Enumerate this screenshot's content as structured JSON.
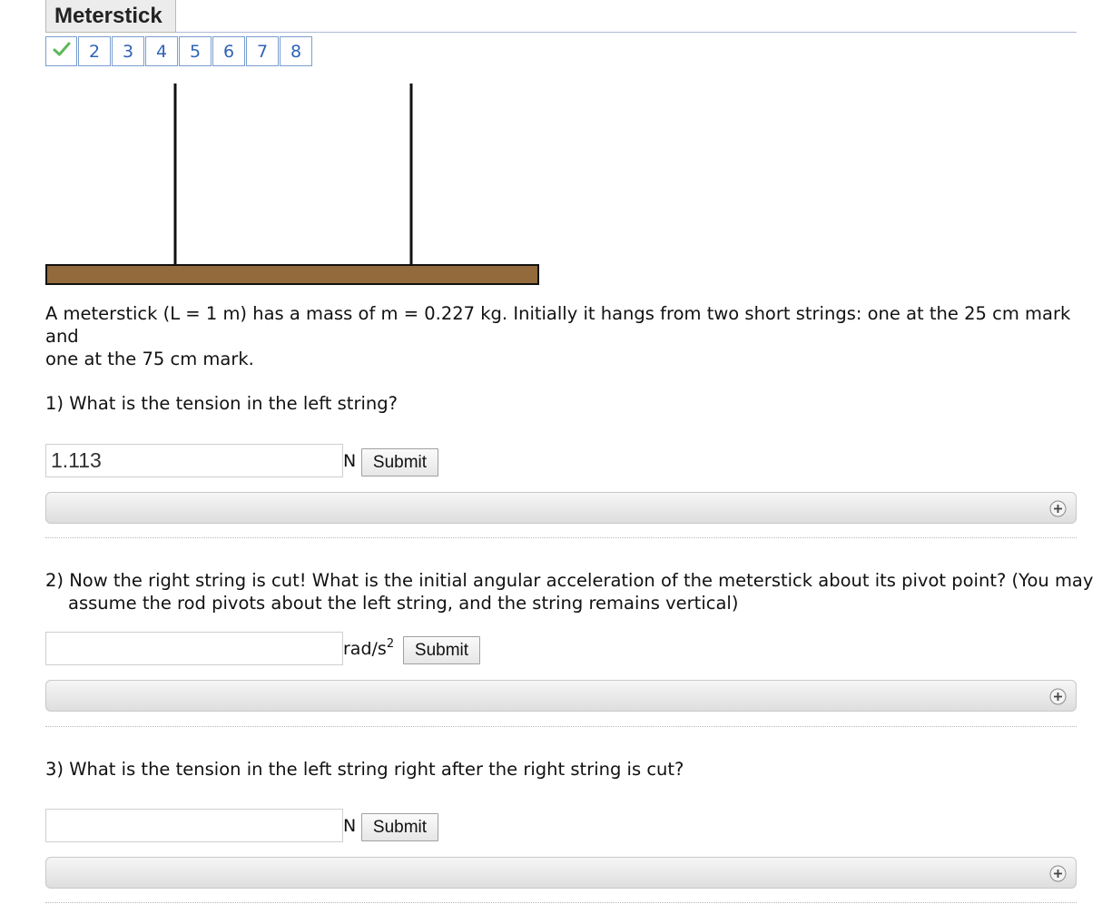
{
  "header": {
    "title": "Meterstick"
  },
  "steps": [
    {
      "label": "✓",
      "status": "complete",
      "color": "#5cb85c"
    },
    {
      "label": "2"
    },
    {
      "label": "3"
    },
    {
      "label": "4"
    },
    {
      "label": "5"
    },
    {
      "label": "6"
    },
    {
      "label": "7"
    },
    {
      "label": "8"
    }
  ],
  "figure": {
    "stick_color": "#926a3c",
    "string_color": "#111111"
  },
  "problem": {
    "line1": "A meterstick (L = 1 m) has a mass of m = 0.227 kg. Initially it hangs from two short strings: one at the 25 cm mark and",
    "line2": "one at the 75 cm mark."
  },
  "questions": [
    {
      "text": "1) What is the tension in the left string?",
      "value": "1.113",
      "unit": "N",
      "submit": "Submit"
    },
    {
      "text": "2) Now the right string is cut! What is the initial angular acceleration of the meterstick about its pivot point? (You may assume the rod pivots about the left string, and the string remains vertical)",
      "value": "",
      "unit_base": "rad/s",
      "unit_exp": "2",
      "submit": "Submit"
    },
    {
      "text": "3) What is the tension in the left string right after the right string is cut?",
      "value": "",
      "unit": "N",
      "submit": "Submit"
    }
  ]
}
